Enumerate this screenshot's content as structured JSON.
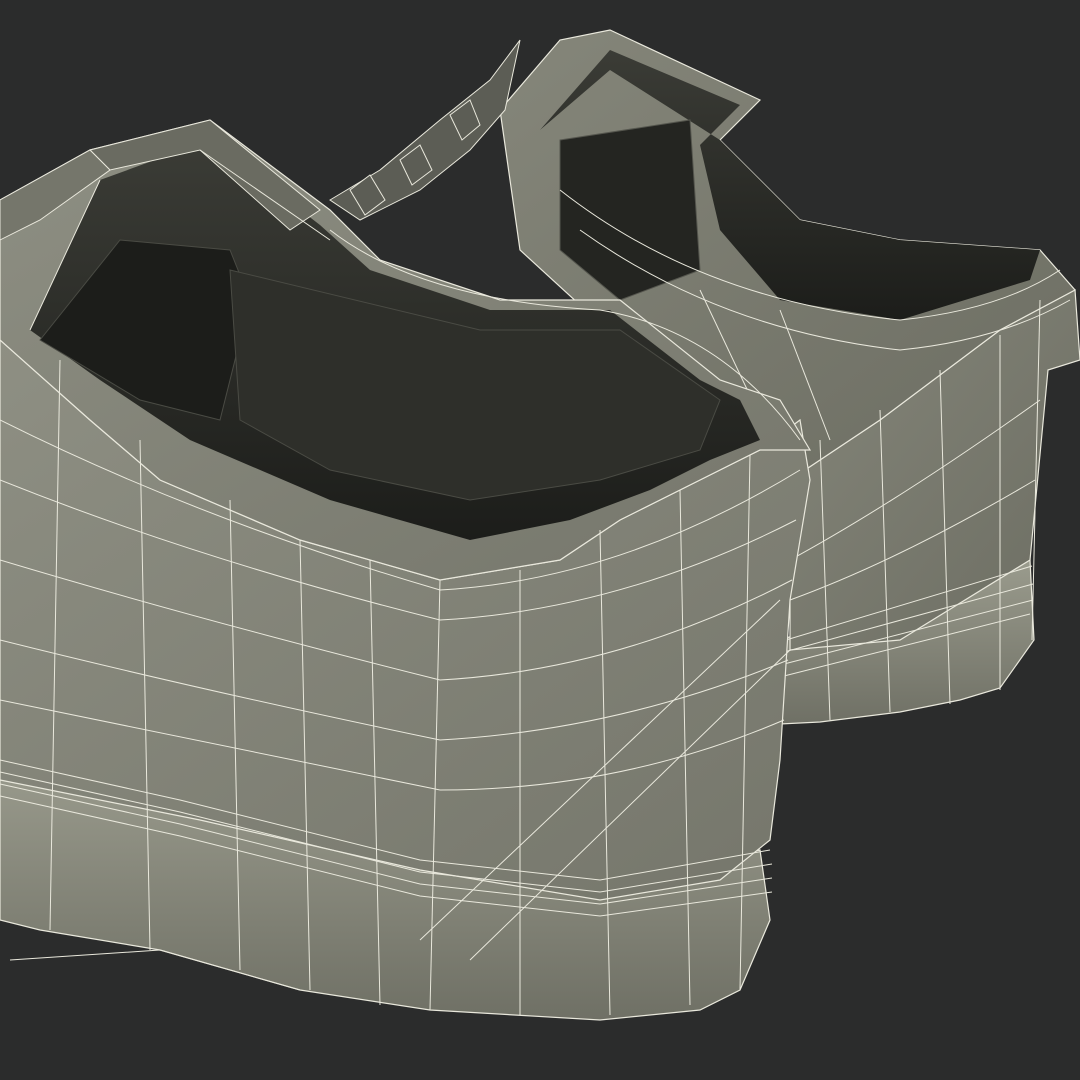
{
  "scene": {
    "subject": "wireframe-shoes-render",
    "colors": {
      "background": "#2b2c2c",
      "shell": "#7f8074",
      "shell_light": "#8d8e82",
      "shell_dark": "#5d5e55",
      "interior": "#1e1f1c",
      "interior_mid": "#34352f",
      "wire": "#e9e8dc",
      "sole": "#8a8b7e"
    }
  }
}
